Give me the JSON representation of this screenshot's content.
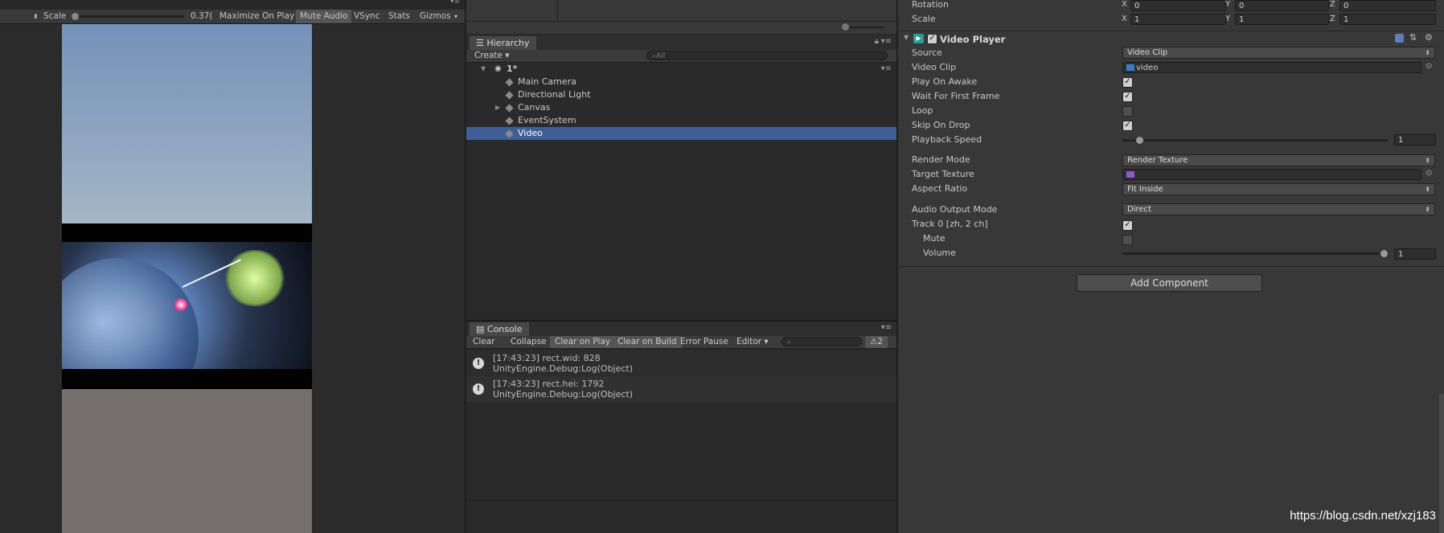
{
  "game": {
    "scale_label": "Scale",
    "scale_value": "0.37(",
    "buttons": [
      "Maximize On Play",
      "Mute Audio",
      "VSync",
      "Stats",
      "Gizmos"
    ]
  },
  "hierarchy": {
    "tab": "Hierarchy",
    "create": "Create",
    "search_placeholder": "All",
    "scene": "1*",
    "items": [
      "Main Camera",
      "Directional Light",
      "Canvas",
      "EventSystem",
      "Video"
    ],
    "selected": "Video"
  },
  "console": {
    "tab": "Console",
    "buttons": [
      "Clear",
      "Collapse",
      "Clear on Play",
      "Clear on Build",
      "Error Pause",
      "Editor"
    ],
    "count": "2",
    "logs": [
      {
        "line1": "[17:43:23] rect.wid: 828",
        "line2": "UnityEngine.Debug:Log(Object)"
      },
      {
        "line1": "[17:43:23] rect.hei: 1792",
        "line2": "UnityEngine.Debug:Log(Object)"
      }
    ]
  },
  "inspector": {
    "transform": {
      "rotation_label": "Rotation",
      "scale_label": "Scale",
      "rotation": {
        "x": "0",
        "y": "0",
        "z": "0"
      },
      "scale": {
        "x": "1",
        "y": "1",
        "z": "1"
      },
      "axes": [
        "X",
        "Y",
        "Z"
      ]
    },
    "component_title": "Video Player",
    "fields": {
      "source": {
        "label": "Source",
        "value": "Video Clip"
      },
      "video_clip": {
        "label": "Video Clip",
        "value": "video"
      },
      "play_on_awake": {
        "label": "Play On Awake",
        "checked": true
      },
      "wait_first_frame": {
        "label": "Wait For First Frame",
        "checked": true
      },
      "loop": {
        "label": "Loop",
        "checked": false
      },
      "skip_on_drop": {
        "label": "Skip On Drop",
        "checked": true
      },
      "playback_speed": {
        "label": "Playback Speed",
        "value": "1",
        "level": 0.05
      },
      "render_mode": {
        "label": "Render Mode",
        "value": "Render Texture"
      },
      "target_texture": {
        "label": "Target Texture",
        "value": ""
      },
      "aspect_ratio": {
        "label": "Aspect Ratio",
        "value": "Fit Inside"
      },
      "audio_output_mode": {
        "label": "Audio Output Mode",
        "value": "Direct"
      },
      "track0": {
        "label": "Track 0 [zh, 2 ch]",
        "checked": true
      },
      "mute": {
        "label": "Mute",
        "checked": false
      },
      "volume": {
        "label": "Volume",
        "value": "1",
        "level": 1.0
      }
    },
    "add_component": "Add Component"
  },
  "watermark": "https://blog.csdn.net/xzj183",
  "colors": {
    "selection": "#3e5f96",
    "panel": "#383838",
    "accent_icon": "#2a9d8f"
  }
}
